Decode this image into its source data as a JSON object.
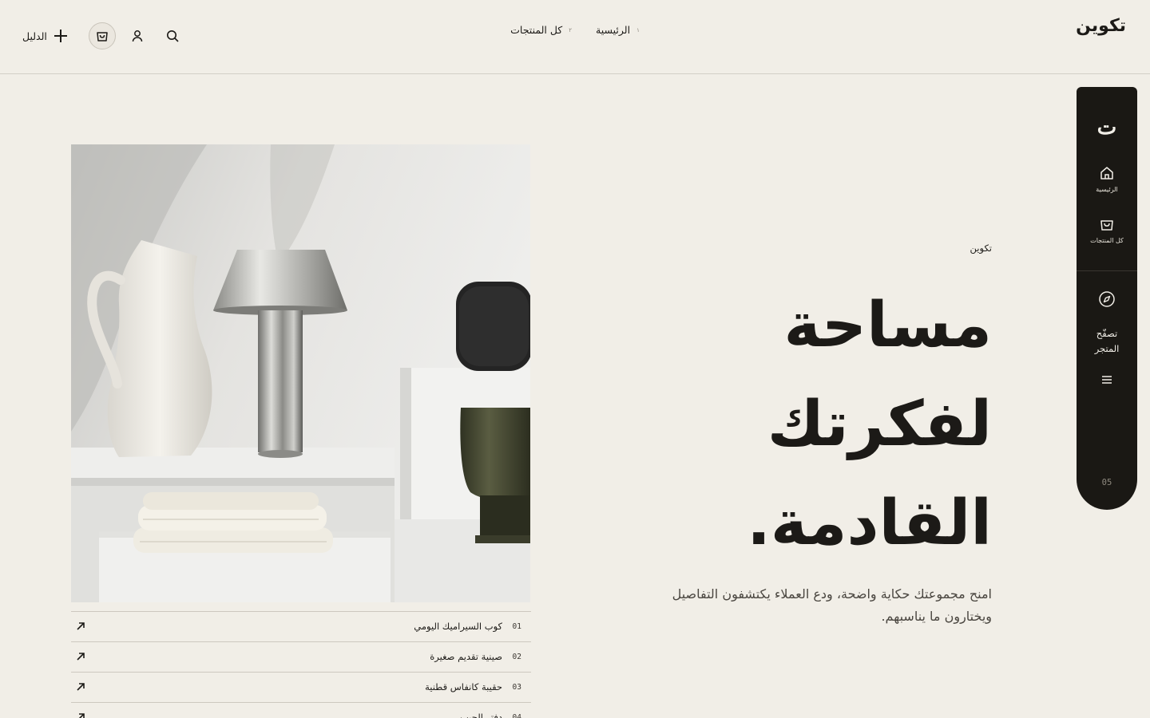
{
  "brand": {
    "name": "تكوين",
    "rail_mark": "ت"
  },
  "nav": [
    {
      "num": "١",
      "label": "الرئيسية"
    },
    {
      "num": "٢",
      "label": "كل المنتجات"
    }
  ],
  "header_actions": {
    "guide_label": "الدليل"
  },
  "rail": {
    "items": [
      {
        "label": "الرئيسية"
      },
      {
        "label": "كل المنتجات"
      }
    ],
    "browse_line1": "تصفّح",
    "browse_line2": "المتجر",
    "count": "05"
  },
  "hero": {
    "eyebrow": "تكوين",
    "title_lines": [
      "مساحة",
      "لفكرتك",
      "القادمة."
    ],
    "description": "امنح مجموعتك حكاية واضحة، ودع العملاء يكتشفون التفاصيل ويختارون ما يناسبهم."
  },
  "products": [
    {
      "num": "01",
      "name": "كوب السيراميك اليومي"
    },
    {
      "num": "02",
      "name": "صينية تقديم صغيرة"
    },
    {
      "num": "03",
      "name": "حقيبة كانفاس قطنية"
    },
    {
      "num": "04",
      "name": "دفتر الجيب"
    }
  ],
  "colors": {
    "background": "#f1eee7",
    "rail": "#1a1814",
    "text": "#1c1a17"
  },
  "icons": [
    "plus-icon",
    "cart-icon",
    "user-icon",
    "search-icon",
    "home-icon",
    "compass-icon",
    "menu-icon",
    "arrow-up-right-icon"
  ]
}
